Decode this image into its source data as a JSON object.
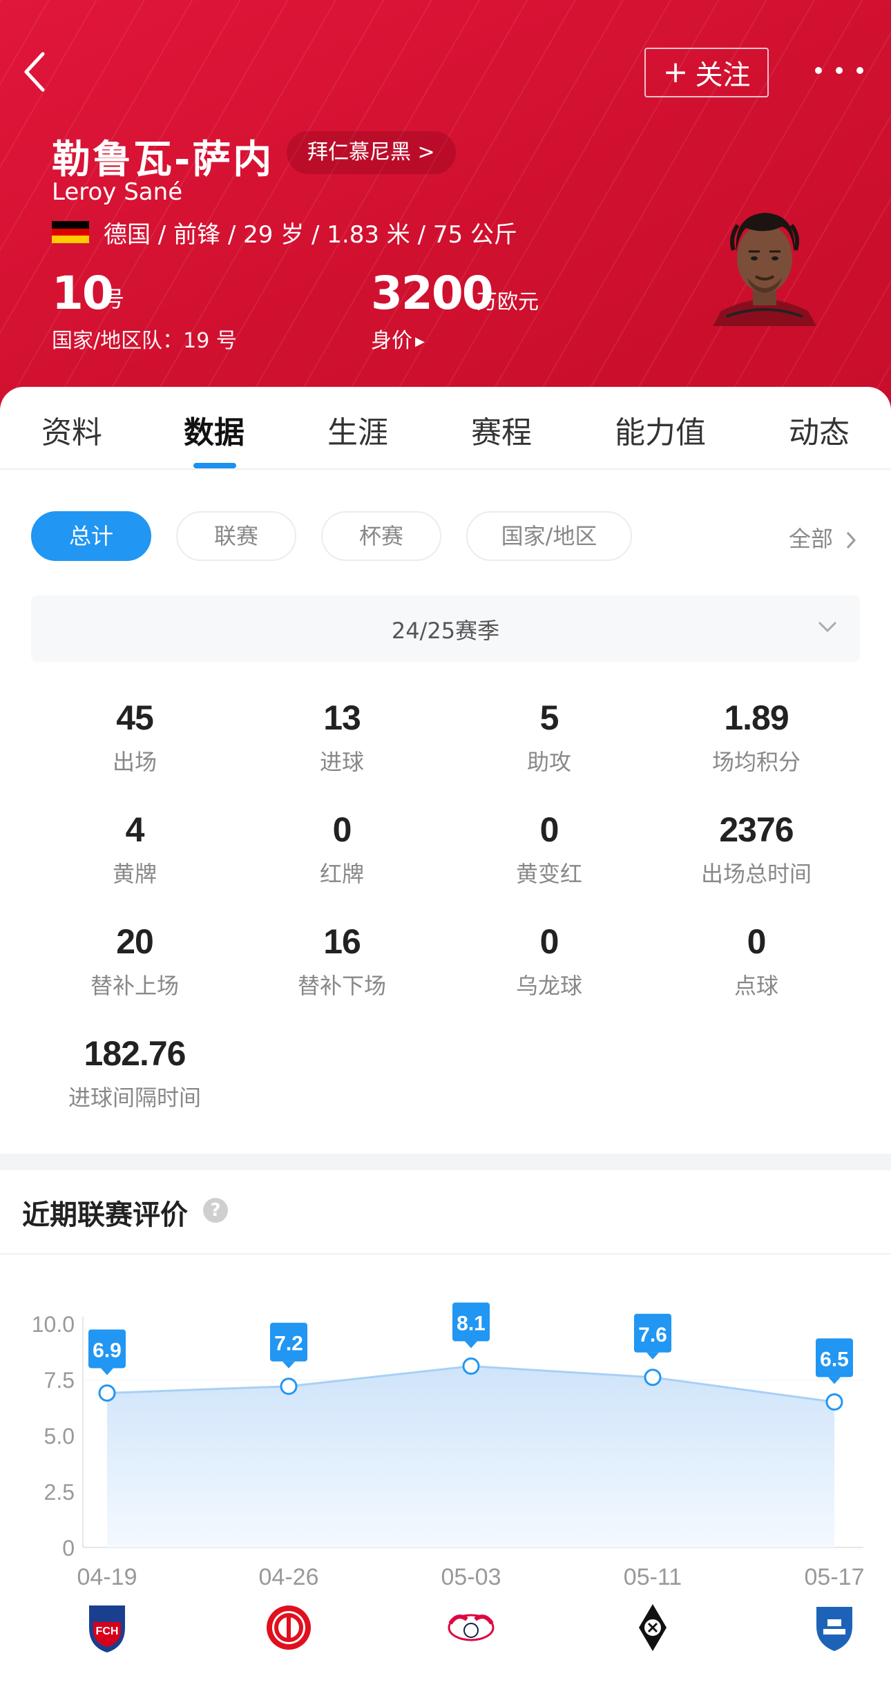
{
  "header": {
    "follow_label": "关注",
    "player_name_cn": "勒鲁瓦-萨内",
    "club_label": "拜仁慕尼黑 >",
    "player_name_en": "Leroy Sané",
    "info_line": "德国 / 前锋 / 29 岁 / 1.83 米 / 75 公斤",
    "shirt_number": "10",
    "shirt_number_unit": "号",
    "national_number": "国家/地区队：19 号",
    "market_value": "3200",
    "market_value_unit": "万欧元",
    "market_value_label": "身价",
    "flag_colors": [
      "#000000",
      "#dd0000",
      "#ffcc00"
    ]
  },
  "tabs": [
    {
      "label": "资料"
    },
    {
      "label": "数据",
      "active": true
    },
    {
      "label": "生涯"
    },
    {
      "label": "赛程"
    },
    {
      "label": "能力值"
    },
    {
      "label": "动态"
    }
  ],
  "filters": {
    "chips": [
      {
        "label": "总计",
        "active": true
      },
      {
        "label": "联赛"
      },
      {
        "label": "杯赛"
      },
      {
        "label": "国家/地区"
      }
    ],
    "all_label": "全部"
  },
  "season": {
    "label": "24/25赛季"
  },
  "stats": [
    {
      "value": "45",
      "label": "出场"
    },
    {
      "value": "13",
      "label": "进球"
    },
    {
      "value": "5",
      "label": "助攻"
    },
    {
      "value": "1.89",
      "label": "场均积分"
    },
    {
      "value": "4",
      "label": "黄牌"
    },
    {
      "value": "0",
      "label": "红牌"
    },
    {
      "value": "0",
      "label": "黄变红"
    },
    {
      "value": "2376",
      "label": "出场总时间"
    },
    {
      "value": "20",
      "label": "替补上场"
    },
    {
      "value": "16",
      "label": "替补下场"
    },
    {
      "value": "0",
      "label": "乌龙球"
    },
    {
      "value": "0",
      "label": "点球"
    },
    {
      "value": "182.76",
      "label": "进球间隔时间"
    }
  ],
  "rating": {
    "title": "近期联赛评价",
    "help_icon": "question-icon"
  },
  "chart_data": {
    "type": "area",
    "categories": [
      "04-19",
      "04-26",
      "05-03",
      "05-11",
      "05-17"
    ],
    "values": [
      6.9,
      7.2,
      8.1,
      7.6,
      6.5
    ],
    "data_labels": [
      "6.9",
      "7.2",
      "8.1",
      "7.6",
      "6.5"
    ],
    "ylim": [
      0,
      10
    ],
    "y_ticks": [
      "0",
      "2.5",
      "5.0",
      "7.5",
      "10.0"
    ],
    "y_tick_values": [
      0,
      2.5,
      5,
      7.5,
      10
    ],
    "opponent_logos": [
      "heidenheim-logo",
      "mainz-logo",
      "leipzig-logo",
      "gladbach-logo",
      "hoffenheim-logo"
    ],
    "colors": {
      "line": "#a8d0f5",
      "badge": "#2196f3",
      "point_fill": "#ffffff",
      "point_stroke": "#2196f3"
    }
  }
}
